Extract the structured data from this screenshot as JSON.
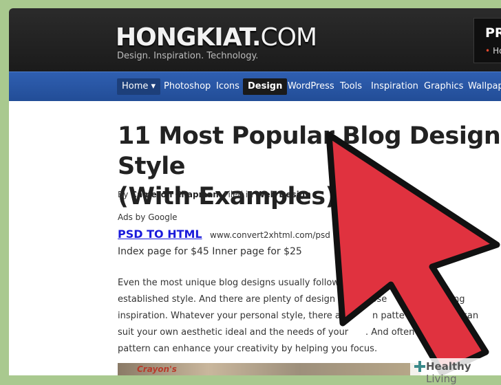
{
  "header": {
    "logo_main": "HONGKIAT",
    "logo_dot": ".",
    "logo_com": "COM",
    "tagline": "Design. Inspiration. Technology.",
    "promo_title": "PR",
    "promo_sub": "Ho"
  },
  "nav": {
    "items": [
      {
        "label": "Home ▾"
      },
      {
        "label": "Photoshop"
      },
      {
        "label": "Icons"
      },
      {
        "label": "Design"
      },
      {
        "label": "WordPress"
      },
      {
        "label": "Tools"
      },
      {
        "label": "Inspiration"
      },
      {
        "label": "Graphics"
      },
      {
        "label": "Wallpape"
      }
    ],
    "active": "Design"
  },
  "article": {
    "title_line1": "11 Most Popular Blog Design Style",
    "title_line2": "(With Examples)",
    "by": "By ",
    "author": "Cameron Chapman",
    "filed": ". Filed in ",
    "category": "Web Design",
    "ads_label": "Ads by Google",
    "ad_link": "PSD TO HTML",
    "ad_url": "www.convert2xhtml.com/psd",
    "ad_desc": "Index page for $45 Inner page for $25",
    "para_lines": [
      "Even the most unique blog designs usually follow,              sort of predef",
      "established style. And there are plenty of design sty     oose         u're looking",
      "inspiration. Whatever your personal style, there are        n patte          e that can",
      "suit your own aesthetic ideal and the needs of your      . And often v        in a pr",
      "pattern can enhance your creativity by helping you focus."
    ],
    "thumb_text": "Crayon's"
  },
  "watermark": {
    "brand": "Healthy",
    "brand_light": " Living"
  },
  "colors": {
    "background": "#a9c98f",
    "nav_blue": "#2a58a8",
    "cursor_red": "#e0323f",
    "link_blue": "#1a1adb"
  }
}
